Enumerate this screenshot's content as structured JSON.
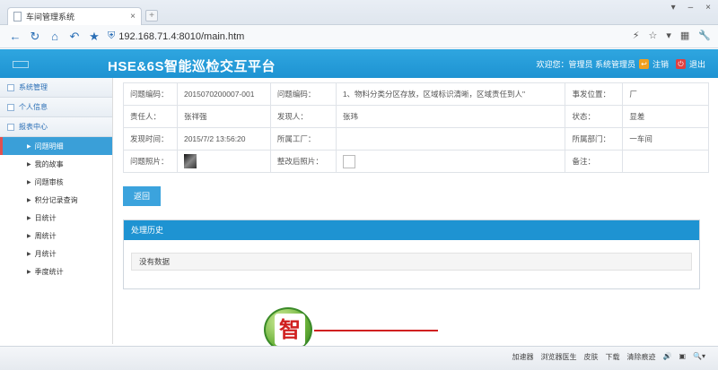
{
  "browser": {
    "tab_title": "车间管理系统",
    "tab_close": "×",
    "new_tab": "+",
    "window_controls": [
      "▾",
      "–",
      "×"
    ],
    "address": "192.168.71.4:8010/main.htm",
    "nav_right": [
      "⚡",
      "☆",
      "▾",
      "▦",
      "🔧"
    ]
  },
  "header": {
    "title": "HSE&6S智能巡检交互平台",
    "welcome": "欢迎您：管理员 系统管理员",
    "logout": "注销",
    "exit": "退出",
    "color": "#1e93d2"
  },
  "sidebar": {
    "sections": [
      {
        "label": "系统管理"
      },
      {
        "label": "个人信息"
      },
      {
        "label": "报表中心"
      }
    ],
    "items": [
      {
        "label": "问题明细",
        "active": true
      },
      {
        "label": "我的故事"
      },
      {
        "label": "问题审核"
      },
      {
        "label": "积分记录查询"
      },
      {
        "label": "日统计"
      },
      {
        "label": "周统计"
      },
      {
        "label": "月统计"
      },
      {
        "label": "季度统计"
      }
    ]
  },
  "detail": {
    "r1": {
      "l1": "问题编码：",
      "v1": "2015070200007-001",
      "l2": "问题编码：",
      "v2": "1、物料分类分区存放，区域标识清晰，区域责任到人\"",
      "l3": "事发位置：",
      "v3": "厂"
    },
    "r2": {
      "l1": "责任人：",
      "v1": "张祥强",
      "l2": "发现人：",
      "v2": "张玮",
      "l3": "状态：",
      "v3": "显差"
    },
    "r3": {
      "l1": "发现时间：",
      "v1": "2015/7/2 13:56:20",
      "l2": "所属工厂：",
      "v2": "",
      "l3": "所属部门：",
      "v3": "一车间"
    },
    "r4": {
      "l1": "问题照片：",
      "l2": "整改后照片：",
      "l3": "备注：",
      "v3": ""
    }
  },
  "back_button": "返回",
  "history": {
    "title": "处理历史",
    "empty": "没有数据"
  },
  "watermark": {
    "glyph": "智"
  },
  "statusbar": [
    "加速器",
    "浏览器医生",
    "皮肤",
    "下载",
    "清除痕迹",
    "🔊",
    "▣",
    "🔍▾"
  ]
}
